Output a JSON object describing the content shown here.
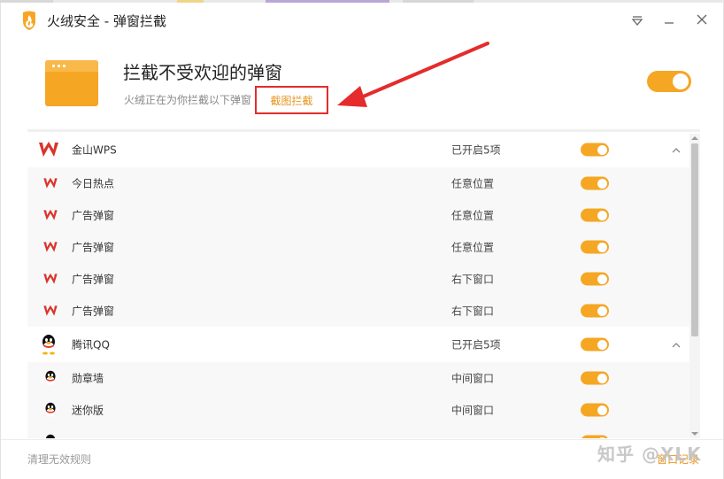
{
  "window": {
    "title": "火绒安全 - 弹窗拦截"
  },
  "hero": {
    "title": "拦截不受欢迎的弹窗",
    "subtitle": "火绒正在为你拦截以下弹窗",
    "screenshot_link": "截图拦截",
    "master_toggle_on": true
  },
  "groups": [
    {
      "name": "金山WPS",
      "status": "已开启5项",
      "icon": "wps-icon",
      "enabled": true,
      "expanded": true,
      "items": [
        {
          "name": "今日热点",
          "position": "任意位置",
          "enabled": true
        },
        {
          "name": "广告弹窗",
          "position": "任意位置",
          "enabled": true
        },
        {
          "name": "广告弹窗",
          "position": "任意位置",
          "enabled": true
        },
        {
          "name": "广告弹窗",
          "position": "右下窗口",
          "enabled": true
        },
        {
          "name": "广告弹窗",
          "position": "右下窗口",
          "enabled": true
        }
      ]
    },
    {
      "name": "腾讯QQ",
      "status": "已开启5项",
      "icon": "qq-icon",
      "enabled": true,
      "expanded": true,
      "items": [
        {
          "name": "勋章墙",
          "position": "中间窗口",
          "enabled": true
        },
        {
          "name": "迷你版",
          "position": "中间窗口",
          "enabled": true
        }
      ]
    }
  ],
  "footer": {
    "clear_rules": "清理无效规则",
    "records": "窗口记录"
  },
  "watermark": "知乎 @XLK",
  "colors": {
    "accent": "#f5a623",
    "annotation_red": "#e52b2b",
    "link_orange": "#e6951e",
    "wps_red": "#d9342b"
  }
}
